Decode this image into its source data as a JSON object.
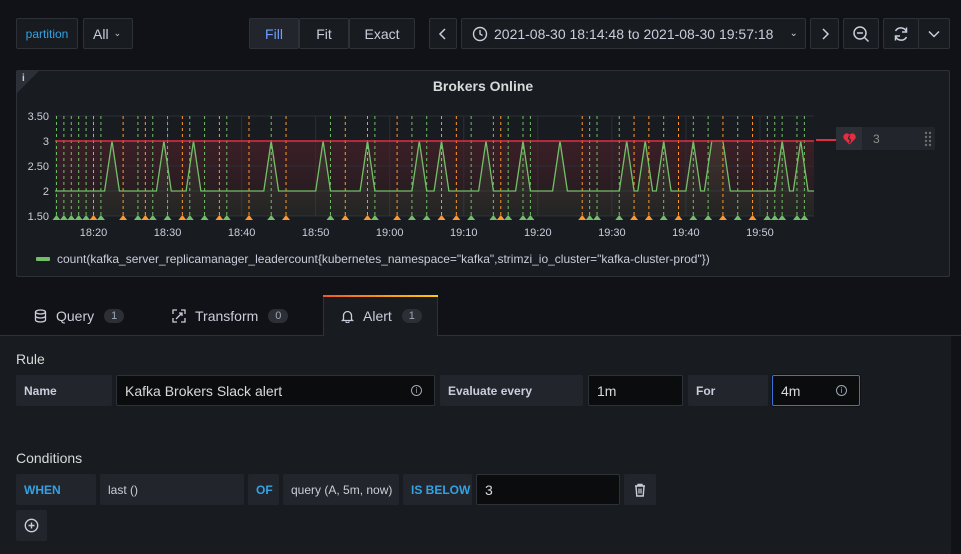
{
  "toolbar": {
    "variable_label": "partition",
    "variable_value": "All",
    "fit_options": [
      "Fill",
      "Fit",
      "Exact"
    ],
    "active_fit": "Fill",
    "time_range": "2021-08-30 18:14:48 to 2021-08-30 19:57:18"
  },
  "panel": {
    "info_glyph": "i",
    "title": "Brokers Online",
    "current_value": "3",
    "legend": "count(kafka_server_replicamanager_leadercount{kubernetes_namespace=\"kafka\",strimzi_io_cluster=\"kafka-cluster-prod\"})"
  },
  "chart_data": {
    "type": "line",
    "y_ticks": [
      "3.50",
      "3",
      "2.50",
      "2",
      "1.50"
    ],
    "ylim": [
      1.5,
      3.5
    ],
    "x_ticks": [
      "18:20",
      "18:30",
      "18:40",
      "18:50",
      "19:00",
      "19:10",
      "19:20",
      "19:30",
      "19:40",
      "19:50"
    ],
    "x_range": [
      "18:14:48",
      "19:57:18"
    ],
    "threshold": 3,
    "series": [
      {
        "name": "count(kafka_server_replicamanager_leadercount{kubernetes_namespace=\"kafka\",strimzi_io_cluster=\"kafka-cluster-prod\"})",
        "color": "#73bf69",
        "points": [
          [
            "18:14:48",
            2
          ],
          [
            "18:21:30",
            2
          ],
          [
            "18:22:30",
            3
          ],
          [
            "18:23:30",
            2
          ],
          [
            "18:28:30",
            2
          ],
          [
            "18:29:30",
            3
          ],
          [
            "18:30:30",
            2
          ],
          [
            "18:32:30",
            2
          ],
          [
            "18:33:30",
            3
          ],
          [
            "18:34:30",
            2
          ],
          [
            "18:43:00",
            2
          ],
          [
            "18:44:00",
            3
          ],
          [
            "18:45:00",
            2
          ],
          [
            "18:50:00",
            2
          ],
          [
            "18:51:00",
            3
          ],
          [
            "18:52:00",
            2
          ],
          [
            "18:56:00",
            2
          ],
          [
            "18:57:00",
            3
          ],
          [
            "18:58:00",
            2
          ],
          [
            "19:03:00",
            2
          ],
          [
            "19:04:00",
            3
          ],
          [
            "19:05:00",
            2
          ],
          [
            "19:06:00",
            2
          ],
          [
            "19:07:00",
            3
          ],
          [
            "19:08:00",
            2
          ],
          [
            "19:12:00",
            2
          ],
          [
            "19:13:00",
            3
          ],
          [
            "19:14:00",
            2
          ],
          [
            "19:17:00",
            2
          ],
          [
            "19:18:00",
            3
          ],
          [
            "19:19:00",
            2
          ],
          [
            "19:22:00",
            2
          ],
          [
            "19:23:00",
            3
          ],
          [
            "19:24:00",
            2
          ],
          [
            "19:31:00",
            2
          ],
          [
            "19:32:00",
            3
          ],
          [
            "19:33:00",
            2
          ],
          [
            "19:33:30",
            2
          ],
          [
            "19:34:30",
            3
          ],
          [
            "19:35:30",
            2
          ],
          [
            "19:36:00",
            2
          ],
          [
            "19:37:00",
            3
          ],
          [
            "19:38:00",
            2
          ],
          [
            "19:40:00",
            2
          ],
          [
            "19:41:00",
            3
          ],
          [
            "19:42:00",
            2
          ],
          [
            "19:42:30",
            2
          ],
          [
            "19:43:30",
            3
          ],
          [
            "19:45:00",
            3
          ],
          [
            "19:46:00",
            2
          ],
          [
            "19:52:00",
            2
          ],
          [
            "19:53:00",
            3
          ],
          [
            "19:54:00",
            2
          ],
          [
            "19:54:30",
            2
          ],
          [
            "19:55:30",
            3
          ],
          [
            "19:56:30",
            2
          ],
          [
            "19:57:18",
            2
          ]
        ]
      }
    ],
    "annotations_ok": [
      "18:15",
      "18:16",
      "18:17",
      "18:18",
      "18:19",
      "18:21",
      "18:26",
      "18:28",
      "18:30",
      "18:33",
      "18:35",
      "18:38",
      "18:44",
      "18:52",
      "18:58",
      "19:03",
      "19:05",
      "19:11",
      "19:14",
      "19:16",
      "19:18",
      "19:19",
      "19:27",
      "19:28",
      "19:31",
      "19:37",
      "19:41",
      "19:43",
      "19:47",
      "19:51",
      "19:52",
      "19:53",
      "19:55",
      "19:56"
    ],
    "annotations_alerting": [
      "18:20",
      "18:24",
      "18:27",
      "18:32",
      "18:37",
      "18:41",
      "18:46",
      "18:54",
      "18:57",
      "19:01",
      "19:07",
      "19:09",
      "19:15",
      "19:26",
      "19:33",
      "19:35",
      "19:39",
      "19:45",
      "19:49"
    ],
    "annotation_colors": {
      "ok": "#37872d",
      "alerting": "#ff9830"
    },
    "grid": true
  },
  "tabs": [
    {
      "label": "Query",
      "count": "1",
      "icon": "database-icon"
    },
    {
      "label": "Transform",
      "count": "0",
      "icon": "transform-icon"
    },
    {
      "label": "Alert",
      "count": "1",
      "icon": "bell-icon"
    }
  ],
  "rule": {
    "heading": "Rule",
    "name_label": "Name",
    "name_value": "Kafka Brokers Slack alert",
    "evaluate_label": "Evaluate every",
    "evaluate_value": "1m",
    "for_label": "For",
    "for_value": "4m"
  },
  "conditions": {
    "heading": "Conditions",
    "when": "WHEN",
    "reducer": "last ()",
    "of": "OF",
    "query": "query (A, 5m, now)",
    "evaluator": "IS BELOW",
    "threshold": "3"
  },
  "colors": {
    "background": "#111217",
    "panel": "#181b1f",
    "accent": "#3d71d9",
    "series": "#73bf69",
    "threshold": "#e02f44"
  }
}
